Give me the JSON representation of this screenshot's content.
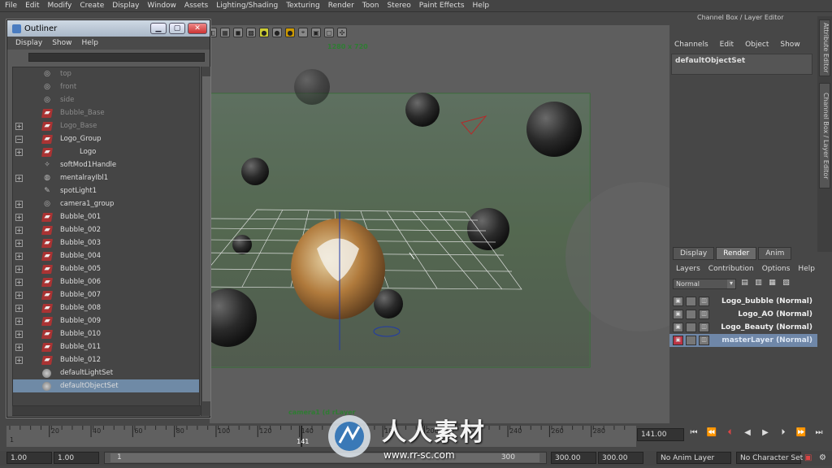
{
  "menubar": [
    "File",
    "Edit",
    "Modify",
    "Create",
    "Display",
    "Window",
    "Assets",
    "Lighting/Shading",
    "Texturing",
    "Render",
    "Toon",
    "Stereo",
    "Paint Effects",
    "Help"
  ],
  "viewport": {
    "resolution": "1280 x 720",
    "camera_label": "camera1 (d                    rLayer"
  },
  "outliner": {
    "title": "Outliner",
    "menu": [
      "Display",
      "Show",
      "Help"
    ],
    "items": [
      {
        "label": "top",
        "icon": "camera-icon",
        "dim": true,
        "expand": ""
      },
      {
        "label": "front",
        "icon": "camera-icon",
        "dim": true,
        "expand": ""
      },
      {
        "label": "side",
        "icon": "camera-icon",
        "dim": true,
        "expand": ""
      },
      {
        "label": "Bubble_Base",
        "icon": "mesh-icon",
        "dim": true,
        "expand": ""
      },
      {
        "label": "Logo_Base",
        "icon": "mesh-icon",
        "dim": true,
        "expand": "+"
      },
      {
        "label": "Logo_Group",
        "icon": "mesh-icon",
        "dim": false,
        "expand": "−"
      },
      {
        "label": "Logo",
        "icon": "mesh-icon",
        "dim": false,
        "expand": "+"
      },
      {
        "label": "softMod1Handle",
        "icon": "handle-icon",
        "dim": false,
        "expand": ""
      },
      {
        "label": "mentalrayIbl1",
        "icon": "ibl-icon",
        "dim": false,
        "expand": "+"
      },
      {
        "label": "spotLight1",
        "icon": "spotlight-icon",
        "dim": false,
        "expand": ""
      },
      {
        "label": "camera1_group",
        "icon": "camera-icon",
        "dim": false,
        "expand": "+"
      },
      {
        "label": "Bubble_001",
        "icon": "mesh-icon",
        "dim": false,
        "expand": "+"
      },
      {
        "label": "Bubble_002",
        "icon": "mesh-icon",
        "dim": false,
        "expand": "+"
      },
      {
        "label": "Bubble_003",
        "icon": "mesh-icon",
        "dim": false,
        "expand": "+"
      },
      {
        "label": "Bubble_004",
        "icon": "mesh-icon",
        "dim": false,
        "expand": "+"
      },
      {
        "label": "Bubble_005",
        "icon": "mesh-icon",
        "dim": false,
        "expand": "+"
      },
      {
        "label": "Bubble_006",
        "icon": "mesh-icon",
        "dim": false,
        "expand": "+"
      },
      {
        "label": "Bubble_007",
        "icon": "mesh-icon",
        "dim": false,
        "expand": "+"
      },
      {
        "label": "Bubble_008",
        "icon": "mesh-icon",
        "dim": false,
        "expand": "+"
      },
      {
        "label": "Bubble_009",
        "icon": "mesh-icon",
        "dim": false,
        "expand": "+"
      },
      {
        "label": "Bubble_010",
        "icon": "mesh-icon",
        "dim": false,
        "expand": "+"
      },
      {
        "label": "Bubble_011",
        "icon": "mesh-icon",
        "dim": false,
        "expand": "+"
      },
      {
        "label": "Bubble_012",
        "icon": "mesh-icon",
        "dim": false,
        "expand": "+"
      },
      {
        "label": "defaultLightSet",
        "icon": "set-icon",
        "dim": false,
        "expand": ""
      },
      {
        "label": "defaultObjectSet",
        "icon": "set-icon",
        "dim": false,
        "expand": "",
        "selected": true
      }
    ]
  },
  "channel_box": {
    "header": "Channel Box / Layer Editor",
    "menu": [
      "Channels",
      "Edit",
      "Object",
      "Show"
    ],
    "object": "defaultObjectSet"
  },
  "side_tabs": [
    "Attribute Editor",
    "Channel Box / Layer Editor"
  ],
  "layer_editor": {
    "tabs": [
      "Display",
      "Render",
      "Anim"
    ],
    "active_tab": "Render",
    "menu": [
      "Layers",
      "Contribution",
      "Options",
      "Help"
    ],
    "mode": "Normal",
    "layers": [
      {
        "name": "Logo_bubble (Normal)",
        "master": false
      },
      {
        "name": "Logo_AO (Normal)",
        "master": false
      },
      {
        "name": "Logo_Beauty (Normal)",
        "master": false
      },
      {
        "name": "masterLayer (Normal)",
        "master": true
      }
    ]
  },
  "timeline": {
    "ticks": [
      "20",
      "40",
      "60",
      "80",
      "100",
      "120",
      "140",
      "160",
      "180",
      "200",
      "220",
      "240",
      "260",
      "280"
    ],
    "tick_start": "1",
    "current_marker": "141",
    "current_frame": "141.00"
  },
  "range": {
    "start": "1.00",
    "start2": "1.00",
    "slider_start": "1",
    "slider_end": "300",
    "end": "300.00",
    "end2": "300.00",
    "anim_layer": "No Anim Layer",
    "char_set": "No Character Set"
  },
  "watermark": {
    "text": "人人素材",
    "url": "www.rr-sc.com"
  }
}
